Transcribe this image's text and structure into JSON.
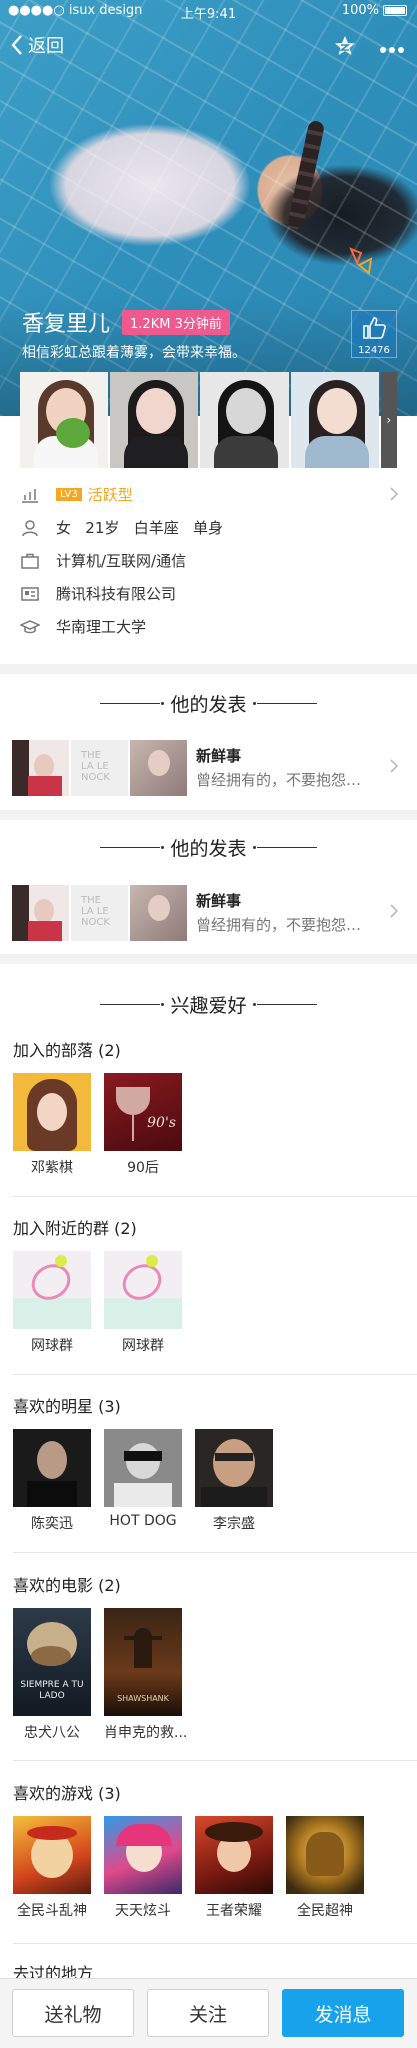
{
  "status": {
    "carrier": "●●●●○ isux design",
    "time": "上午9:41",
    "battery": "100%"
  },
  "nav": {
    "back_label": "返回"
  },
  "profile": {
    "name": "香复里儿",
    "distance_badge": "1.2KM 3分钟前",
    "signature": "相信彩虹总跟着薄雾，会带来幸福。",
    "likes": "12476",
    "level": "LV3",
    "level_text": "活跃型",
    "basic": "女   21岁   白羊座   单身",
    "industry": "计算机/互联网/通信",
    "company": "腾讯科技有限公司",
    "school": "华南理工大学"
  },
  "sections": {
    "posts_title": "他的发表",
    "posts_title2": "他的发表",
    "hobbies_title": "兴趣爱好"
  },
  "posts": [
    {
      "title": "新鲜事",
      "subtitle": "曾经拥有的，不要抱怨…"
    },
    {
      "title": "新鲜事",
      "subtitle": "曾经拥有的，不要抱怨…"
    }
  ],
  "groups": [
    {
      "title": "加入的部落 (2)",
      "items": [
        "邓紫棋",
        "90后"
      ]
    },
    {
      "title": "加入附近的群 (2)",
      "items": [
        "网球群",
        "网球群"
      ]
    },
    {
      "title": "喜欢的明星 (3)",
      "items": [
        "陈奕迅",
        "HOT DOG",
        "李宗盛"
      ]
    },
    {
      "title": "喜欢的电影 (2)",
      "items": [
        "忠犬八公",
        "肖申克的救..."
      ]
    },
    {
      "title": "喜欢的游戏 (3)",
      "items": [
        "全民斗乱神",
        "天天炫斗",
        "王者荣耀",
        "全民超神"
      ]
    },
    {
      "title": "去过的地方",
      "items": []
    }
  ],
  "poster_text": {
    "tribe2": "90's",
    "movie1": "SIEMPRE A TU LADO",
    "movie2": "SHAWSHANK"
  },
  "buttons": {
    "gift": "送礼物",
    "follow": "关注",
    "message": "发消息"
  },
  "colors": {
    "accent": "#18a2ec",
    "badge": "#ee5a8d",
    "level": "#f5a623"
  }
}
